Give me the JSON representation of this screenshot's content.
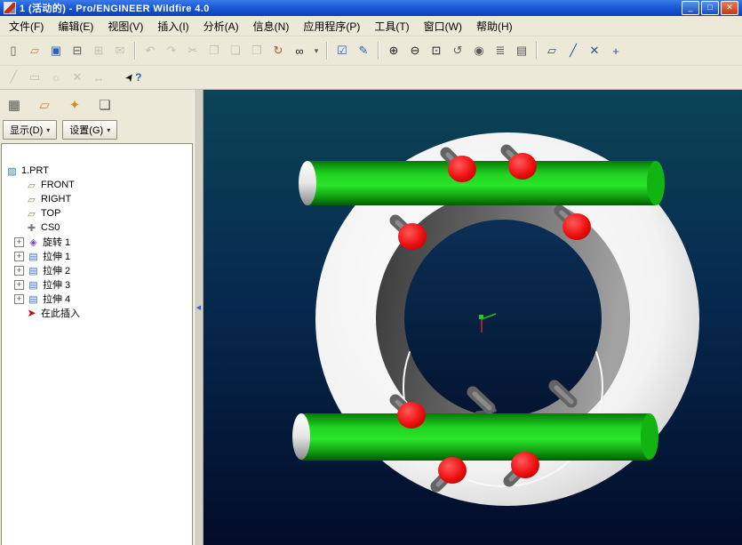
{
  "window": {
    "title": "1 (活动的) - Pro/ENGINEER Wildfire 4.0"
  },
  "menu": {
    "items": [
      "文件(F)",
      "编辑(E)",
      "视图(V)",
      "插入(I)",
      "分析(A)",
      "信息(N)",
      "应用程序(P)",
      "工具(T)",
      "窗口(W)",
      "帮助(H)"
    ]
  },
  "tree_header": {
    "show": "显示(D)",
    "settings": "设置(G)"
  },
  "tree": {
    "items": [
      {
        "label": "1.PRT",
        "icon": "part"
      },
      {
        "label": "FRONT",
        "icon": "plane"
      },
      {
        "label": "RIGHT",
        "icon": "plane"
      },
      {
        "label": "TOP",
        "icon": "plane"
      },
      {
        "label": "CS0",
        "icon": "csys"
      },
      {
        "label": "旋转 1",
        "icon": "revolve",
        "expandable": true
      },
      {
        "label": "拉伸 1",
        "icon": "extrude",
        "expandable": true
      },
      {
        "label": "拉伸 2",
        "icon": "extrude",
        "expandable": true
      },
      {
        "label": "拉伸 3",
        "icon": "extrude",
        "expandable": true
      },
      {
        "label": "拉伸 4",
        "icon": "extrude",
        "expandable": true
      },
      {
        "label": "在此插入",
        "icon": "insert"
      }
    ]
  },
  "icons": {
    "minimize": "_",
    "maximize": "□",
    "close": "✕",
    "new": "▯",
    "open": "▱",
    "save": "▣",
    "print": "⊟",
    "preview": "⊞",
    "send": "✉",
    "undo": "↶",
    "redo": "↷",
    "cut": "✂",
    "copy": "❐",
    "paste": "❏",
    "paste_special": "❒",
    "regen": "↻",
    "find": "∞",
    "dropdown": "▾",
    "select_filter": "☑",
    "smart_select": "✎",
    "zoom_in": "⊕",
    "zoom_out": "⊖",
    "refit": "⊡",
    "reorient": "↺",
    "views": "◉",
    "layers": "≣",
    "view_mgr": "▤",
    "dplane": "▱",
    "daxis": "╱",
    "dpoint": "✕",
    "dcsys": "+",
    "sk_line": "╱",
    "sk_rect": "▭",
    "sk_circle": "○",
    "sk_cross": "✕",
    "sk_dim": "↔",
    "pointer": "➤",
    "help": "?",
    "tree_filter": "▦",
    "folder_add": "▱",
    "favorites": "✦",
    "tree_switch": "❏",
    "collapse": "◀",
    "expand": "+",
    "part": "▧",
    "plane": "▱",
    "csys": "✚",
    "revolve": "◈",
    "extrude": "▤",
    "insert": "➤"
  },
  "colors": {
    "titlebar": "#1c5ad8",
    "chrome": "#ece9d8",
    "viewport_top": "#0b4456",
    "viewport_bottom": "#020c28",
    "model_flange": "#f2f2f2",
    "model_bore": "#6e6e6e",
    "model_tube": "#2ae42a",
    "model_bolt": "#ee0f0f",
    "model_pin": "#646464"
  }
}
